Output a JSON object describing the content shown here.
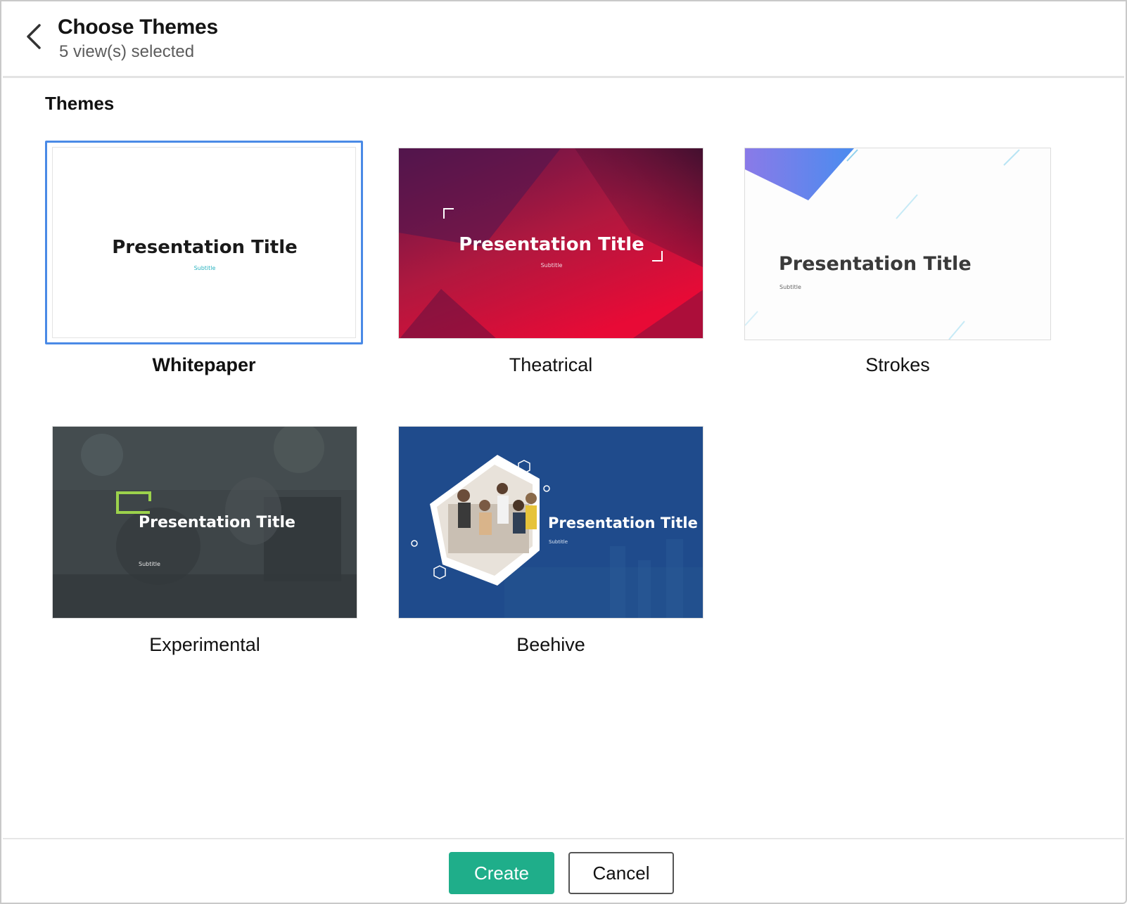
{
  "header": {
    "title": "Choose Themes",
    "subtitle": "5 view(s) selected",
    "back_icon": "chevron-left-icon"
  },
  "section_title": "Themes",
  "themes": [
    {
      "name": "Whitepaper",
      "selected": true,
      "preview_title": "Presentation Title",
      "preview_subtitle": "Subtitle"
    },
    {
      "name": "Theatrical",
      "selected": false,
      "preview_title": "Presentation Title",
      "preview_subtitle": "Subtitle"
    },
    {
      "name": "Strokes",
      "selected": false,
      "preview_title": "Presentation Title",
      "preview_subtitle": "Subtitle"
    },
    {
      "name": "Experimental",
      "selected": false,
      "preview_title": "Presentation Title",
      "preview_subtitle": "Subtitle"
    },
    {
      "name": "Beehive",
      "selected": false,
      "preview_title": "Presentation Title",
      "preview_subtitle": "Subtitle"
    }
  ],
  "footer": {
    "create_label": "Create",
    "cancel_label": "Cancel"
  },
  "colors": {
    "accent": "#1fae8a",
    "selection": "#4a8ae6"
  }
}
